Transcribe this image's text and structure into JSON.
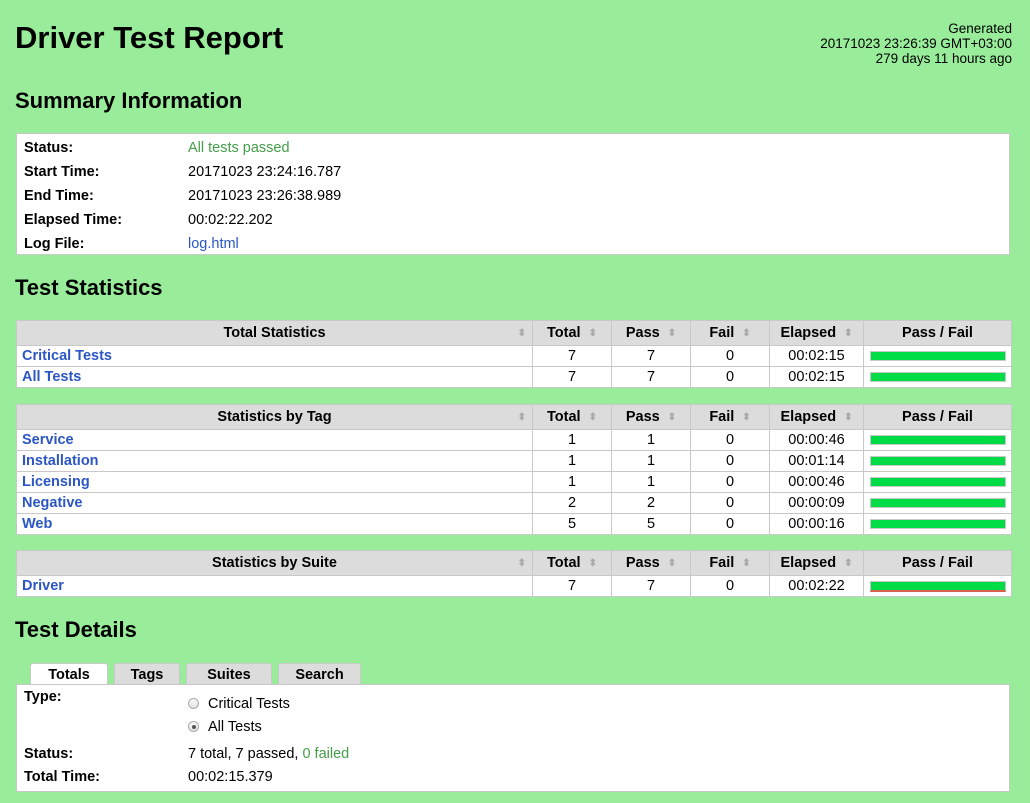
{
  "header": {
    "title": "Driver Test Report",
    "generated_label": "Generated",
    "generated_at": "20171023 23:26:39 GMT+03:00",
    "generated_ago": "279 days 11 hours ago"
  },
  "summary": {
    "heading": "Summary Information",
    "rows": [
      {
        "label": "Status:",
        "value": "All tests passed"
      },
      {
        "label": "Start Time:",
        "value": "20171023 23:24:16.787"
      },
      {
        "label": "End Time:",
        "value": "20171023 23:26:38.989"
      },
      {
        "label": "Elapsed Time:",
        "value": "00:02:22.202"
      },
      {
        "label": "Log File:",
        "value": "log.html"
      }
    ]
  },
  "statistics": {
    "heading": "Test Statistics",
    "columns": [
      "Total",
      "Pass",
      "Fail",
      "Elapsed",
      "Pass / Fail"
    ],
    "sort_icon": "sort-arrows-icon",
    "colors": {
      "pass": "#00dc46",
      "fail": "#d9604a"
    },
    "total": {
      "title": "Total Statistics",
      "rows": [
        {
          "name": "Critical Tests",
          "total": "7",
          "pass": "7",
          "fail": "0",
          "elapsed": "00:02:15",
          "pass_ratio": 1.0
        },
        {
          "name": "All Tests",
          "total": "7",
          "pass": "7",
          "fail": "0",
          "elapsed": "00:02:15",
          "pass_ratio": 1.0
        }
      ]
    },
    "tag": {
      "title": "Statistics by Tag",
      "rows": [
        {
          "name": "Service",
          "total": "1",
          "pass": "1",
          "fail": "0",
          "elapsed": "00:00:46",
          "pass_ratio": 1.0
        },
        {
          "name": "Installation",
          "total": "1",
          "pass": "1",
          "fail": "0",
          "elapsed": "00:01:14",
          "pass_ratio": 1.0
        },
        {
          "name": "Licensing",
          "total": "1",
          "pass": "1",
          "fail": "0",
          "elapsed": "00:00:46",
          "pass_ratio": 1.0
        },
        {
          "name": "Negative",
          "total": "2",
          "pass": "2",
          "fail": "0",
          "elapsed": "00:00:09",
          "pass_ratio": 1.0
        },
        {
          "name": "Web",
          "total": "5",
          "pass": "5",
          "fail": "0",
          "elapsed": "00:00:16",
          "pass_ratio": 1.0
        }
      ]
    },
    "suite": {
      "title": "Statistics by Suite",
      "rows": [
        {
          "name": "Driver",
          "total": "7",
          "pass": "7",
          "fail": "0",
          "elapsed": "00:02:22",
          "pass_ratio": 1.0
        }
      ]
    }
  },
  "details": {
    "heading": "Test Details",
    "tabs": [
      "Totals",
      "Tags",
      "Suites",
      "Search"
    ],
    "active_tab": "Totals",
    "type_label": "Type:",
    "type_options": [
      {
        "label": "Critical Tests",
        "checked": false
      },
      {
        "label": "All Tests",
        "checked": true
      }
    ],
    "status_label": "Status:",
    "status_prefix": "7 total, 7 passed, ",
    "status_failed": "0 failed",
    "total_time_label": "Total Time:",
    "total_time": "00:02:15.379"
  }
}
